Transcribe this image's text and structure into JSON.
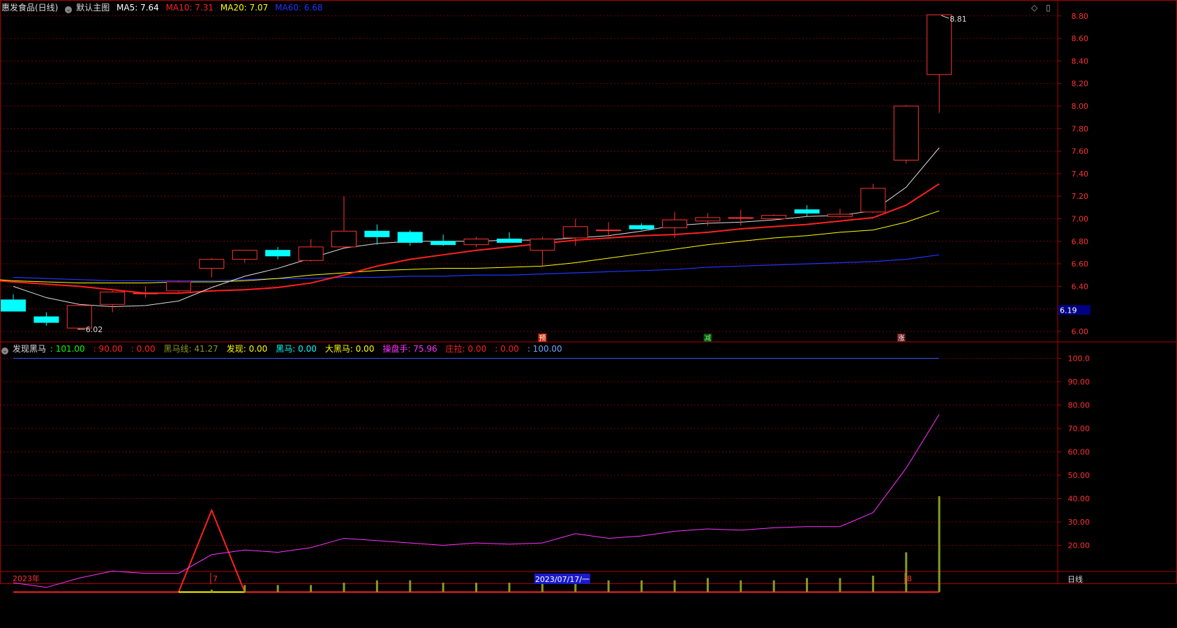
{
  "header": {
    "stock_label": "惠发食品(日线)",
    "main_chart_label": "默认主图",
    "ma5": {
      "label": "MA5: 7.64",
      "color": "#ffffff"
    },
    "ma10": {
      "label": "MA10: 7.31",
      "color": "#ff2020"
    },
    "ma20": {
      "label": "MA20: 7.07",
      "color": "#ffff00"
    },
    "ma60": {
      "label": "MA60: 6.68",
      "color": "#2233ff"
    }
  },
  "indicator_header": {
    "name": "发现黑马",
    "items": [
      {
        "text": ": 101.00",
        "color": "#00ff00"
      },
      {
        "text": ": 90.00",
        "color": "#ff2020"
      },
      {
        "text": ": 0.00",
        "color": "#ff2020"
      },
      {
        "text": "黑马线: 41.27",
        "color": "#8a9a20"
      },
      {
        "text": "发现: 0.00",
        "color": "#ffff00"
      },
      {
        "text": "黑马: 0.00",
        "color": "#00ffff"
      },
      {
        "text": "大黑马: 0.00",
        "color": "#ffff00"
      },
      {
        "text": "操盘手: 75.96",
        "color": "#ff33ff"
      },
      {
        "text": "庄拉: 0.00",
        "color": "#ff2020"
      },
      {
        "text": ": 0.00",
        "color": "#ff2020"
      },
      {
        "text": ": 100.00",
        "color": "#6aa8ff"
      }
    ]
  },
  "price_axis": {
    "ticks": [
      "8.80",
      "8.60",
      "8.40",
      "8.20",
      "8.00",
      "7.80",
      "7.60",
      "7.40",
      "7.20",
      "7.00",
      "6.80",
      "6.60",
      "6.40",
      "6.00"
    ],
    "current_price": "6.19"
  },
  "indicator_axis": {
    "ticks": [
      "100.0",
      "90.00",
      "80.00",
      "70.00",
      "60.00",
      "50.00",
      "40.00",
      "30.00",
      "20.00"
    ]
  },
  "annotations": {
    "high_label": "8.81",
    "low_label": "6.02",
    "signal_yu": "预",
    "signal_jian": "减",
    "signal_zhang": "涨"
  },
  "date_axis": {
    "year_label": "2023年",
    "month7": "7",
    "cursor_date": "2023/07/17/一",
    "month8": "8"
  },
  "period_label": "日线",
  "colors": {
    "up": "#ff3232",
    "down": "#00ffff",
    "grid": "#7a0000",
    "axis": "#b00000",
    "blue_line": "#3355ff",
    "magenta": "#ff33ff",
    "olive": "#8a9a20"
  },
  "chart_data": {
    "type": "candlestick",
    "price_range": [
      5.9,
      8.9
    ],
    "candles": [
      {
        "o": 6.28,
        "h": 6.33,
        "l": 6.18,
        "c": 6.18
      },
      {
        "o": 6.13,
        "h": 6.17,
        "l": 6.05,
        "c": 6.08
      },
      {
        "o": 6.03,
        "h": 6.24,
        "l": 6.02,
        "c": 6.23
      },
      {
        "o": 6.24,
        "h": 6.36,
        "l": 6.17,
        "c": 6.35
      },
      {
        "o": 6.34,
        "h": 6.4,
        "l": 6.3,
        "c": 6.34
      },
      {
        "o": 6.36,
        "h": 6.45,
        "l": 6.35,
        "c": 6.44
      },
      {
        "o": 6.56,
        "h": 6.65,
        "l": 6.48,
        "c": 6.64
      },
      {
        "o": 6.64,
        "h": 6.72,
        "l": 6.61,
        "c": 6.72
      },
      {
        "o": 6.72,
        "h": 6.75,
        "l": 6.64,
        "c": 6.67
      },
      {
        "o": 6.63,
        "h": 6.82,
        "l": 6.62,
        "c": 6.75
      },
      {
        "o": 6.75,
        "h": 7.2,
        "l": 6.73,
        "c": 6.89
      },
      {
        "o": 6.89,
        "h": 6.95,
        "l": 6.77,
        "c": 6.84
      },
      {
        "o": 6.88,
        "h": 6.9,
        "l": 6.76,
        "c": 6.79
      },
      {
        "o": 6.8,
        "h": 6.86,
        "l": 6.76,
        "c": 6.77
      },
      {
        "o": 6.77,
        "h": 6.84,
        "l": 6.75,
        "c": 6.82
      },
      {
        "o": 6.82,
        "h": 6.88,
        "l": 6.79,
        "c": 6.79
      },
      {
        "o": 6.72,
        "h": 6.84,
        "l": 6.58,
        "c": 6.82
      },
      {
        "o": 6.83,
        "h": 7.0,
        "l": 6.76,
        "c": 6.93
      },
      {
        "o": 6.9,
        "h": 6.97,
        "l": 6.84,
        "c": 6.9
      },
      {
        "o": 6.94,
        "h": 6.96,
        "l": 6.9,
        "c": 6.91
      },
      {
        "o": 6.92,
        "h": 7.06,
        "l": 6.83,
        "c": 6.99
      },
      {
        "o": 6.98,
        "h": 7.05,
        "l": 6.94,
        "c": 7.01
      },
      {
        "o": 7.01,
        "h": 7.08,
        "l": 6.94,
        "c": 7.01
      },
      {
        "o": 7.0,
        "h": 7.04,
        "l": 6.99,
        "c": 7.03
      },
      {
        "o": 7.08,
        "h": 7.12,
        "l": 7.02,
        "c": 7.05
      },
      {
        "o": 7.02,
        "h": 7.09,
        "l": 7.01,
        "c": 7.04
      },
      {
        "o": 7.06,
        "h": 7.31,
        "l": 7.05,
        "c": 7.27
      },
      {
        "o": 7.52,
        "h": 8.01,
        "l": 7.49,
        "c": 8.0
      },
      {
        "o": 8.28,
        "h": 8.81,
        "l": 7.94,
        "c": 8.81
      }
    ],
    "ma5": [
      6.4,
      6.3,
      6.24,
      6.22,
      6.23,
      6.27,
      6.39,
      6.49,
      6.56,
      6.65,
      6.74,
      6.78,
      6.8,
      6.8,
      6.8,
      6.81,
      6.81,
      6.83,
      6.85,
      6.89,
      6.94,
      6.96,
      6.97,
      6.99,
      7.02,
      7.03,
      7.07,
      7.28,
      7.63
    ],
    "ma10": [
      6.46,
      6.44,
      6.42,
      6.4,
      6.37,
      6.34,
      6.34,
      6.36,
      6.37,
      6.39,
      6.43,
      6.5,
      6.58,
      6.64,
      6.68,
      6.72,
      6.75,
      6.78,
      6.81,
      6.83,
      6.85,
      6.86,
      6.88,
      6.91,
      6.93,
      6.95,
      6.98,
      7.01,
      7.12,
      7.31
    ],
    "ma20": [
      6.47,
      6.45,
      6.44,
      6.43,
      6.43,
      6.43,
      6.44,
      6.44,
      6.45,
      6.47,
      6.5,
      6.52,
      6.54,
      6.55,
      6.56,
      6.56,
      6.57,
      6.58,
      6.61,
      6.65,
      6.69,
      6.73,
      6.77,
      6.8,
      6.83,
      6.85,
      6.88,
      6.9,
      6.97,
      7.07
    ],
    "ma60": [
      6.48,
      6.47,
      6.46,
      6.45,
      6.45,
      6.45,
      6.45,
      6.46,
      6.47,
      6.47,
      6.48,
      6.48,
      6.49,
      6.49,
      6.5,
      6.5,
      6.51,
      6.52,
      6.53,
      6.54,
      6.55,
      6.57,
      6.58,
      6.59,
      6.6,
      6.61,
      6.62,
      6.64,
      6.68
    ],
    "indicator_range": [
      0,
      107
    ],
    "blue_line_value": 100,
    "magenta": [
      4,
      2,
      6,
      9,
      8,
      8,
      16,
      18,
      17,
      19,
      23,
      22,
      21,
      20,
      21,
      20.5,
      21,
      25,
      23,
      24,
      26,
      27,
      26.5,
      27.5,
      28,
      28,
      34,
      53,
      76
    ],
    "olive_bars": [
      0,
      0,
      0,
      0,
      0,
      0,
      1,
      3,
      3,
      3,
      4,
      5,
      5,
      4,
      4,
      4,
      4,
      5,
      5,
      5,
      5,
      6,
      5,
      5,
      6,
      6,
      7,
      17,
      41
    ],
    "red_triangle": {
      "start_index": 5,
      "peak_index": 6,
      "end_index": 7,
      "peak_value": 35
    }
  }
}
